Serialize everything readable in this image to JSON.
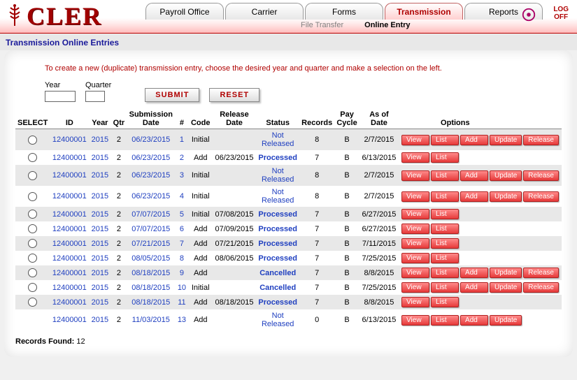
{
  "app": {
    "logo_text": "CLER"
  },
  "nav": {
    "tabs": [
      "Payroll Office",
      "Carrier",
      "Forms",
      "Transmission",
      "Reports"
    ],
    "active_tab": 3,
    "subtabs": [
      "File Transfer",
      "Online Entry"
    ],
    "active_sub": 1,
    "logoff_l1": "LOG",
    "logoff_l2": "OFF"
  },
  "page": {
    "title": "Transmission Online Entries",
    "intro": "To create a new (duplicate) transmission entry, choose the desired year and quarter and make a selection on the left.",
    "year_label": "Year",
    "quarter_label": "Quarter",
    "submit": "SUBMIT",
    "reset": "RESET",
    "records_found_label": "Records Found:",
    "records_found_value": "12"
  },
  "columns": {
    "select": "SELECT",
    "id": "ID",
    "year": "Year",
    "qtr": "Qtr",
    "sub": "Submission Date",
    "num": "#",
    "code": "Code",
    "rel": "Release Date",
    "status": "Status",
    "records": "Records",
    "pay": "Pay Cycle",
    "asof": "As of Date",
    "options": "Options"
  },
  "option_labels": {
    "view": "View",
    "list": "List",
    "add": "Add",
    "update": "Update",
    "release": "Release"
  },
  "status_labels": {
    "not_released": "Not Released",
    "processed": "Processed",
    "cancelled": "Cancelled"
  },
  "rows": [
    {
      "sel": true,
      "id": "12400001",
      "yr": "2015",
      "qtr": "2",
      "sub": "06/23/2015",
      "num": "1",
      "code": "Initial",
      "rel": "",
      "status": "not_released",
      "rec": "8",
      "pay": "B",
      "asof": "2/7/2015",
      "ops": [
        "view",
        "list",
        "add",
        "update",
        "release"
      ],
      "zebra": true
    },
    {
      "sel": true,
      "id": "12400001",
      "yr": "2015",
      "qtr": "2",
      "sub": "06/23/2015",
      "num": "2",
      "code": "Add",
      "rel": "06/23/2015",
      "status": "processed",
      "rec": "7",
      "pay": "B",
      "asof": "6/13/2015",
      "ops": [
        "view",
        "list"
      ],
      "zebra": false
    },
    {
      "sel": true,
      "id": "12400001",
      "yr": "2015",
      "qtr": "2",
      "sub": "06/23/2015",
      "num": "3",
      "code": "Initial",
      "rel": "",
      "status": "not_released",
      "rec": "8",
      "pay": "B",
      "asof": "2/7/2015",
      "ops": [
        "view",
        "list",
        "add",
        "update",
        "release"
      ],
      "zebra": true
    },
    {
      "sel": true,
      "id": "12400001",
      "yr": "2015",
      "qtr": "2",
      "sub": "06/23/2015",
      "num": "4",
      "code": "Initial",
      "rel": "",
      "status": "not_released",
      "rec": "8",
      "pay": "B",
      "asof": "2/7/2015",
      "ops": [
        "view",
        "list",
        "add",
        "update",
        "release"
      ],
      "zebra": false
    },
    {
      "sel": true,
      "id": "12400001",
      "yr": "2015",
      "qtr": "2",
      "sub": "07/07/2015",
      "num": "5",
      "code": "Initial",
      "rel": "07/08/2015",
      "status": "processed",
      "rec": "7",
      "pay": "B",
      "asof": "6/27/2015",
      "ops": [
        "view",
        "list"
      ],
      "zebra": true
    },
    {
      "sel": true,
      "id": "12400001",
      "yr": "2015",
      "qtr": "2",
      "sub": "07/07/2015",
      "num": "6",
      "code": "Add",
      "rel": "07/09/2015",
      "status": "processed",
      "rec": "7",
      "pay": "B",
      "asof": "6/27/2015",
      "ops": [
        "view",
        "list"
      ],
      "zebra": false
    },
    {
      "sel": true,
      "id": "12400001",
      "yr": "2015",
      "qtr": "2",
      "sub": "07/21/2015",
      "num": "7",
      "code": "Add",
      "rel": "07/21/2015",
      "status": "processed",
      "rec": "7",
      "pay": "B",
      "asof": "7/11/2015",
      "ops": [
        "view",
        "list"
      ],
      "zebra": true
    },
    {
      "sel": true,
      "id": "12400001",
      "yr": "2015",
      "qtr": "2",
      "sub": "08/05/2015",
      "num": "8",
      "code": "Add",
      "rel": "08/06/2015",
      "status": "processed",
      "rec": "7",
      "pay": "B",
      "asof": "7/25/2015",
      "ops": [
        "view",
        "list"
      ],
      "zebra": false
    },
    {
      "sel": true,
      "id": "12400001",
      "yr": "2015",
      "qtr": "2",
      "sub": "08/18/2015",
      "num": "9",
      "code": "Add",
      "rel": "",
      "status": "cancelled",
      "rec": "7",
      "pay": "B",
      "asof": "8/8/2015",
      "ops": [
        "view",
        "list",
        "add",
        "update",
        "release"
      ],
      "zebra": true
    },
    {
      "sel": true,
      "id": "12400001",
      "yr": "2015",
      "qtr": "2",
      "sub": "08/18/2015",
      "num": "10",
      "code": "Initial",
      "rel": "",
      "status": "cancelled",
      "rec": "7",
      "pay": "B",
      "asof": "7/25/2015",
      "ops": [
        "view",
        "list",
        "add",
        "update",
        "release"
      ],
      "zebra": false
    },
    {
      "sel": true,
      "id": "12400001",
      "yr": "2015",
      "qtr": "2",
      "sub": "08/18/2015",
      "num": "11",
      "code": "Add",
      "rel": "08/18/2015",
      "status": "processed",
      "rec": "7",
      "pay": "B",
      "asof": "8/8/2015",
      "ops": [
        "view",
        "list"
      ],
      "zebra": true
    },
    {
      "sel": false,
      "id": "12400001",
      "yr": "2015",
      "qtr": "2",
      "sub": "11/03/2015",
      "num": "13",
      "code": "Add",
      "rel": "",
      "status": "not_released",
      "rec": "0",
      "pay": "B",
      "asof": "6/13/2015",
      "ops": [
        "view",
        "list",
        "add",
        "update"
      ],
      "zebra": false
    }
  ]
}
